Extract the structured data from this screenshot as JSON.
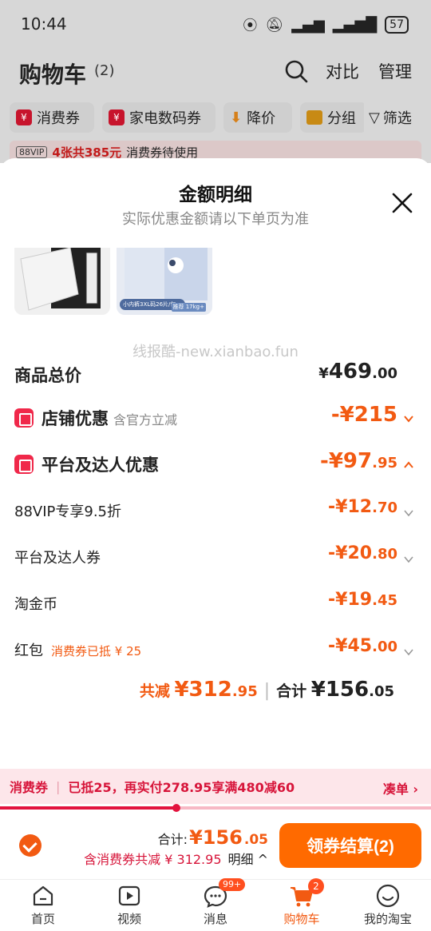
{
  "status_bar": {
    "time": "10:44",
    "battery": "57"
  },
  "cart": {
    "title": "购物车",
    "count": "(2)",
    "compare_label": "对比",
    "manage_label": "管理",
    "chips": [
      "消费券",
      "家电数码券",
      "降价",
      "分组"
    ],
    "filter_label": "筛选",
    "vip_badge": "88VIP",
    "vip_highlight": "4张共385元",
    "vip_text": "消费券待使用"
  },
  "sheet": {
    "title": "金额明细",
    "subtitle": "实际优惠金额请以下单页为准",
    "thumb2_caption": "小内裤3XL码26片/包",
    "thumb2_tag": "推荐 17kg+",
    "watermark": "线报酷-new.xianbao.fun",
    "total_label": "商品总价",
    "total_yen": "¥",
    "total_int": "469",
    "total_dec": ".00",
    "shop_label": "店铺优惠",
    "shop_sub": "含官方立减",
    "shop_amount": "-¥215",
    "platform_label": "平台及达人优惠",
    "platform_amount_int": "-¥97",
    "platform_amount_dec": ".95",
    "items": [
      {
        "label": "88VIP专享9.5折",
        "int": "-¥12",
        "dec": ".70",
        "note": ""
      },
      {
        "label": "平台及达人券",
        "int": "-¥20",
        "dec": ".80",
        "note": ""
      },
      {
        "label": "淘金币",
        "int": "-¥19",
        "dec": ".45",
        "note": ""
      },
      {
        "label": "红包",
        "int": "-¥45",
        "dec": ".00",
        "note": "消费券已抵 ¥ 25"
      }
    ],
    "reduce_label": "共减",
    "reduce_int": "¥312",
    "reduce_dec": ".95",
    "sum_label": "合计",
    "sum_int": "¥156",
    "sum_dec": ".05"
  },
  "coupon_bar": {
    "tag": "消费券",
    "text": "已抵25，再实付278.95享满480减60",
    "action": "凑单 ›",
    "progress_fraction": 0.41
  },
  "checkout": {
    "total_label": "合计:",
    "total_int": "¥156",
    "total_dec": ".05",
    "detail": "含消费券共减 ¥ 312.95",
    "detail_more": "明细 ^",
    "button": "领券结算(2)"
  },
  "tabs": [
    {
      "label": "首页",
      "icon": "home-icon",
      "badge": ""
    },
    {
      "label": "视频",
      "icon": "video-icon",
      "badge": ""
    },
    {
      "label": "消息",
      "icon": "message-icon",
      "badge": "99+"
    },
    {
      "label": "购物车",
      "icon": "cart-icon",
      "badge": "2"
    },
    {
      "label": "我的淘宝",
      "icon": "profile-icon",
      "badge": ""
    }
  ],
  "colors": {
    "accent": "#f25a12",
    "red": "#d7153a",
    "button": "#ff6a00"
  }
}
